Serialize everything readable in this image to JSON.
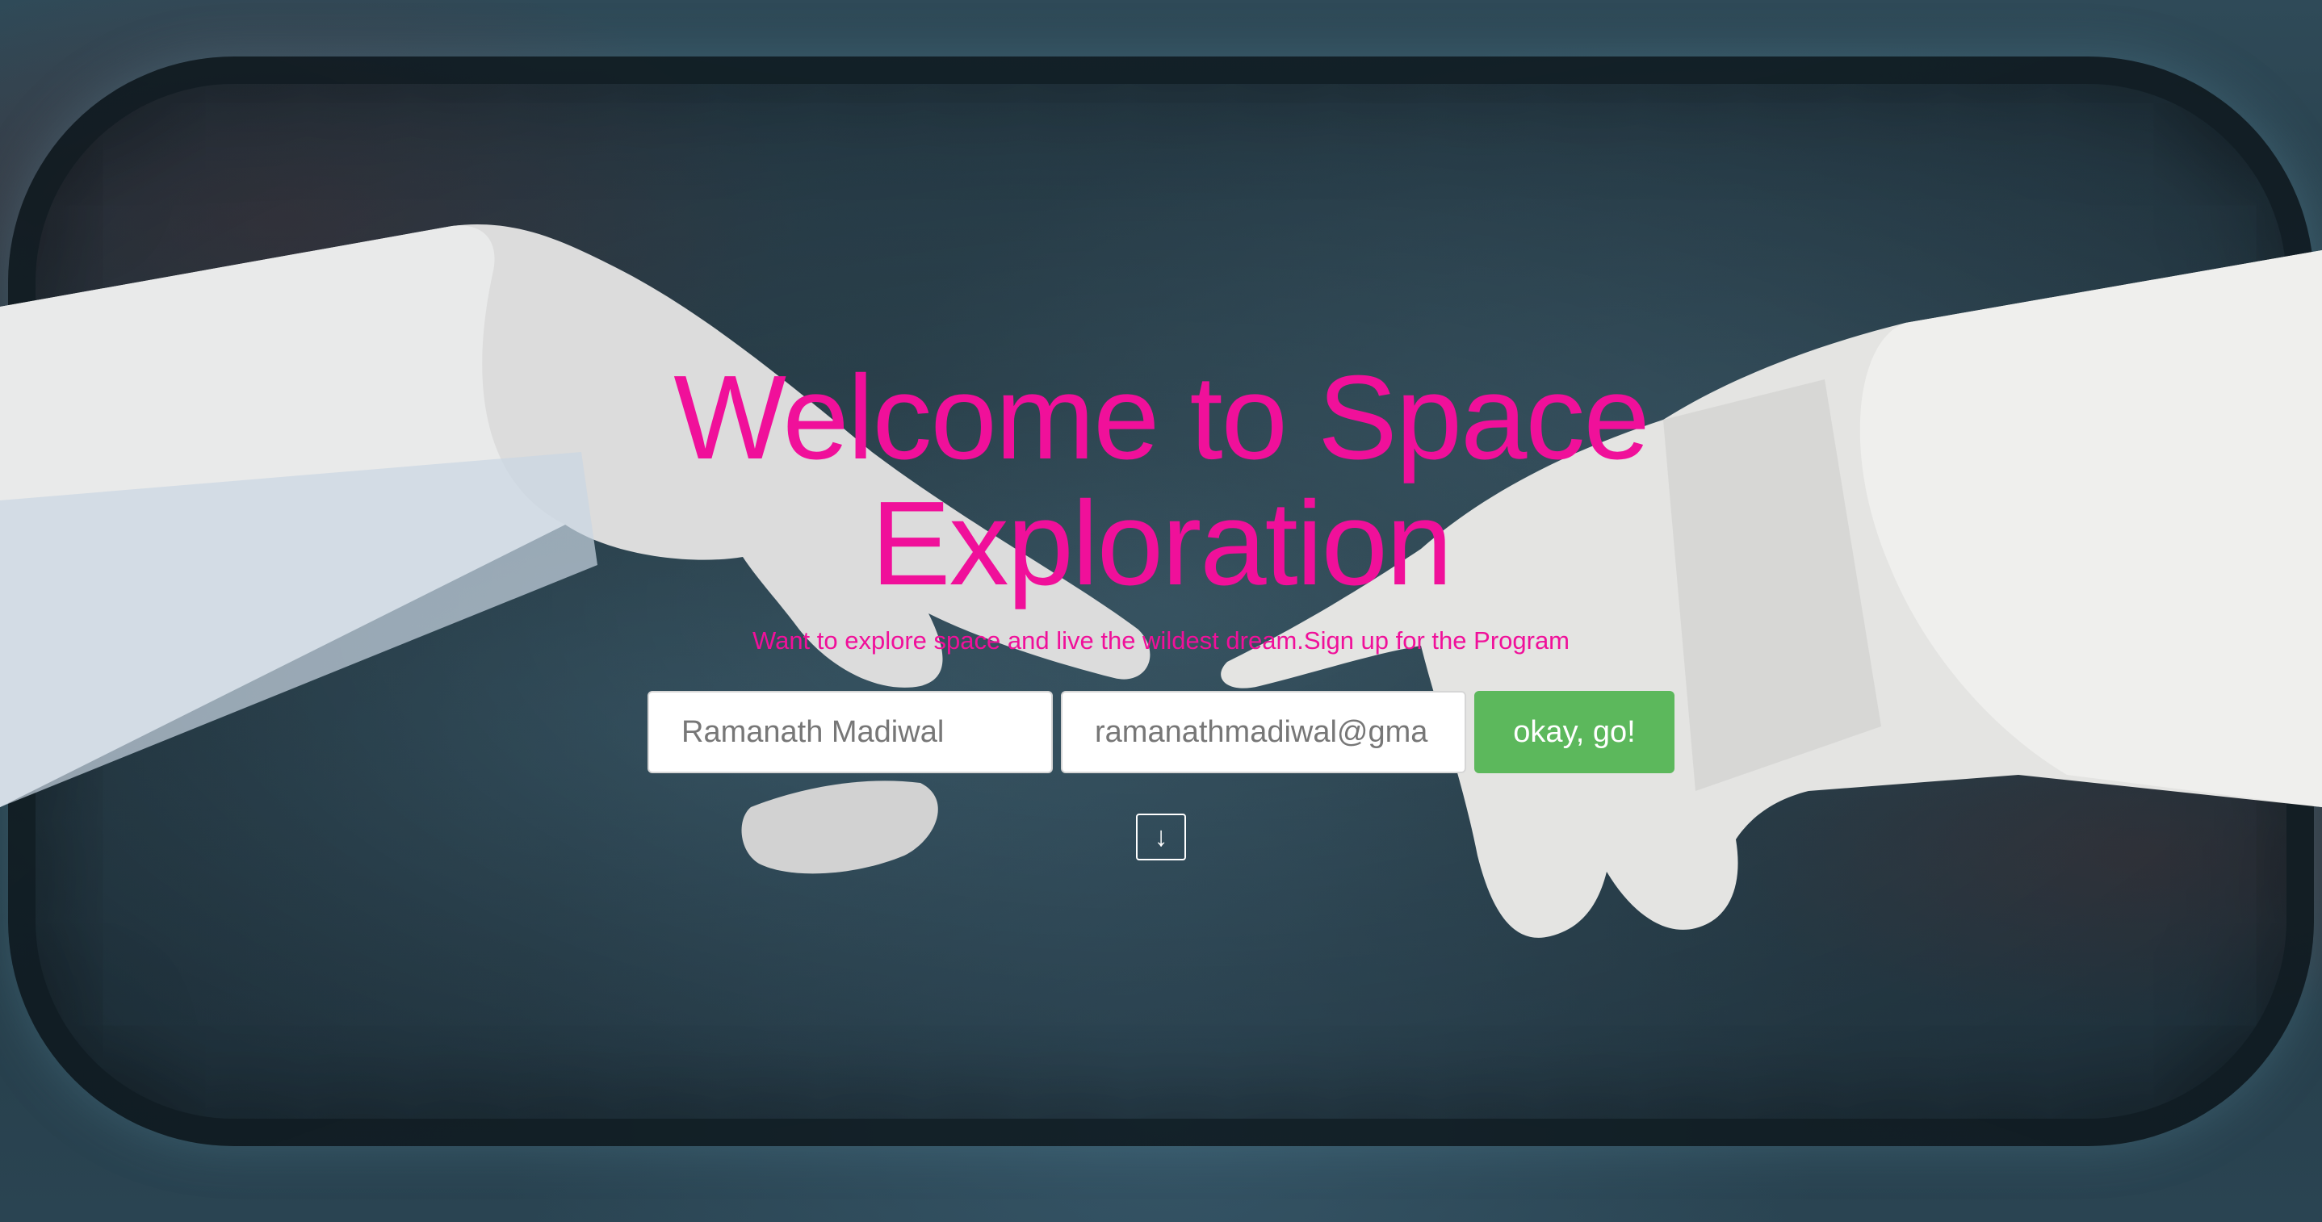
{
  "hero": {
    "title": "Welcome to Space Exploration",
    "subtitle": "Want to explore space and live the wildest dream.Sign up for the Program"
  },
  "form": {
    "name_value": "Ramanath Madiwal",
    "email_value": "ramanathmadiwal@gma",
    "submit_label": "okay, go!"
  },
  "scroll_button": {
    "label": "↓"
  },
  "colors": {
    "title": "#f0109a",
    "button": "#5cb85c",
    "background": "#2a4452"
  }
}
